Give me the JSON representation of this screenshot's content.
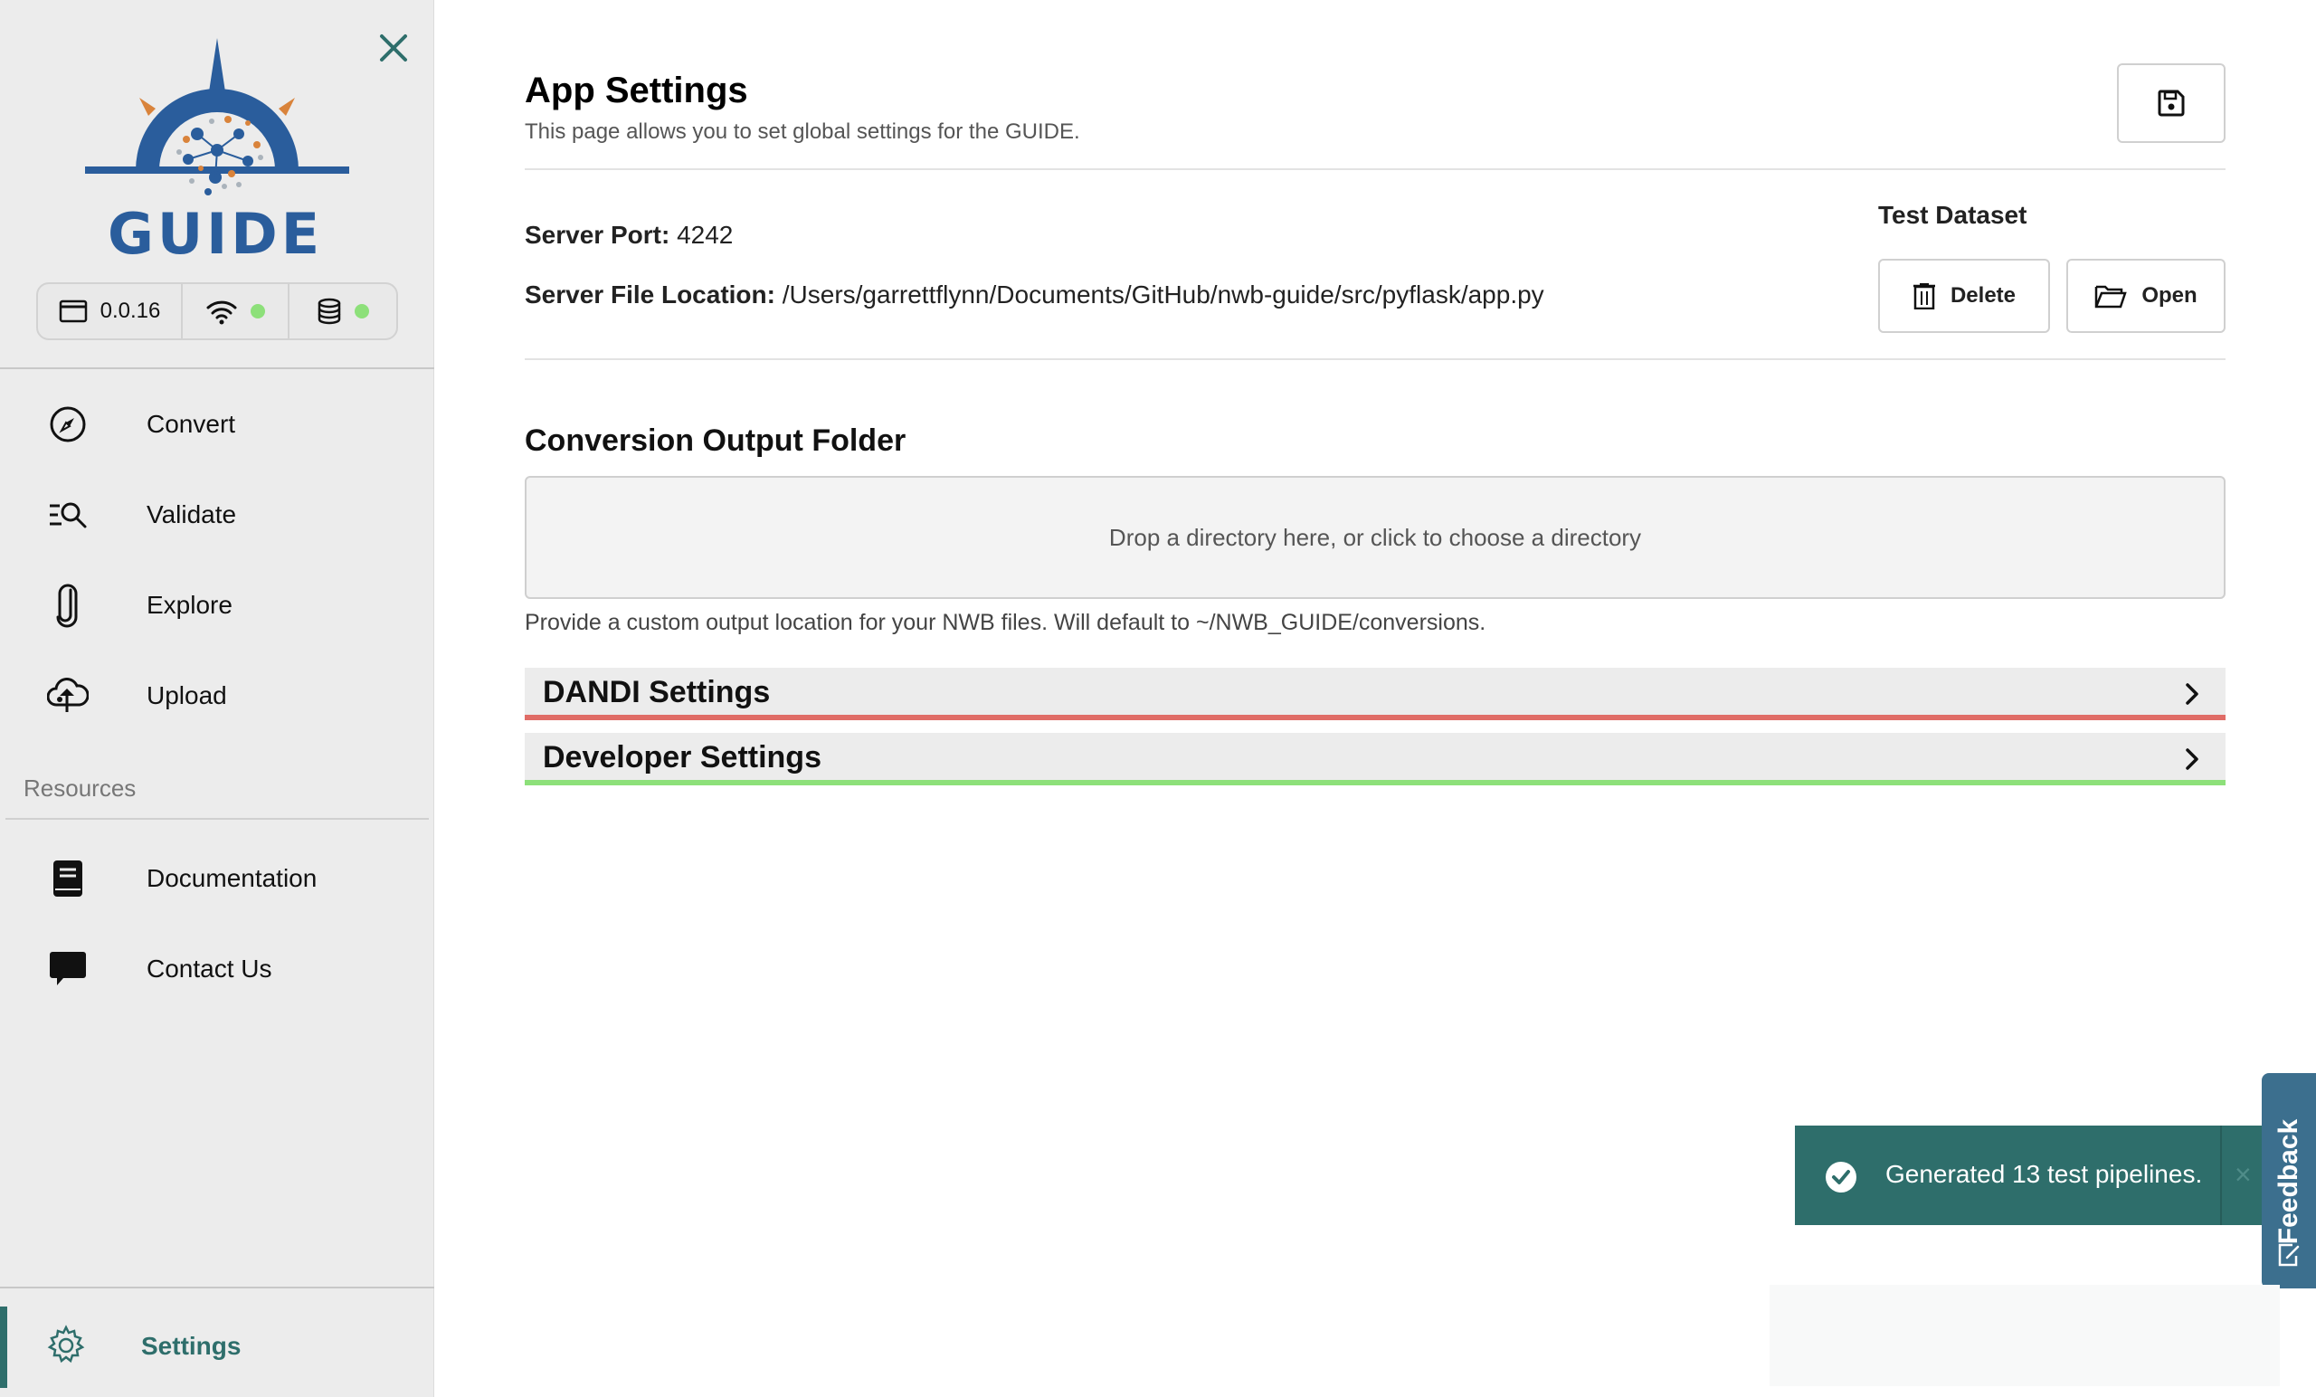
{
  "sidebar": {
    "logo_text": "GUIDE",
    "status": {
      "version": "0.0.16"
    },
    "nav": [
      {
        "label": "Convert",
        "icon": "compass-icon"
      },
      {
        "label": "Validate",
        "icon": "search-list-icon"
      },
      {
        "label": "Explore",
        "icon": "paperclip-icon"
      },
      {
        "label": "Upload",
        "icon": "cloud-upload-icon"
      }
    ],
    "resources_label": "Resources",
    "resources": [
      {
        "label": "Documentation",
        "icon": "book-icon"
      },
      {
        "label": "Contact Us",
        "icon": "chat-bubble-icon"
      }
    ],
    "settings_label": "Settings"
  },
  "main": {
    "title": "App Settings",
    "subtitle": "This page allows you to set global settings for the GUIDE.",
    "server_port_label": "Server Port:",
    "server_port_value": "4242",
    "server_file_label": "Server File Location:",
    "server_file_value": "/Users/garrettflynn/Documents/GitHub/nwb-guide/src/pyflask/app.py",
    "test_dataset_label": "Test Dataset",
    "delete_label": "Delete",
    "open_label": "Open",
    "output_title": "Conversion Output Folder",
    "dropzone_text": "Drop a directory here, or click to choose a directory",
    "output_help": "Provide a custom output location for your NWB files. Will default to ~/NWB_GUIDE/conversions.",
    "accordions": [
      {
        "label": "DANDI Settings",
        "status_color": "#e06c66"
      },
      {
        "label": "Developer Settings",
        "status_color": "#8de07a"
      }
    ]
  },
  "toast": {
    "message": "Generated 13 test pipelines.",
    "close": "×"
  },
  "feedback": {
    "label": "Feedback"
  },
  "colors": {
    "accent": "#2e6e6b",
    "online_dot": "#8de07a",
    "logo_blue": "#2a5d9c",
    "logo_orange": "#d9833b",
    "feedback": "#3c6f8e"
  }
}
